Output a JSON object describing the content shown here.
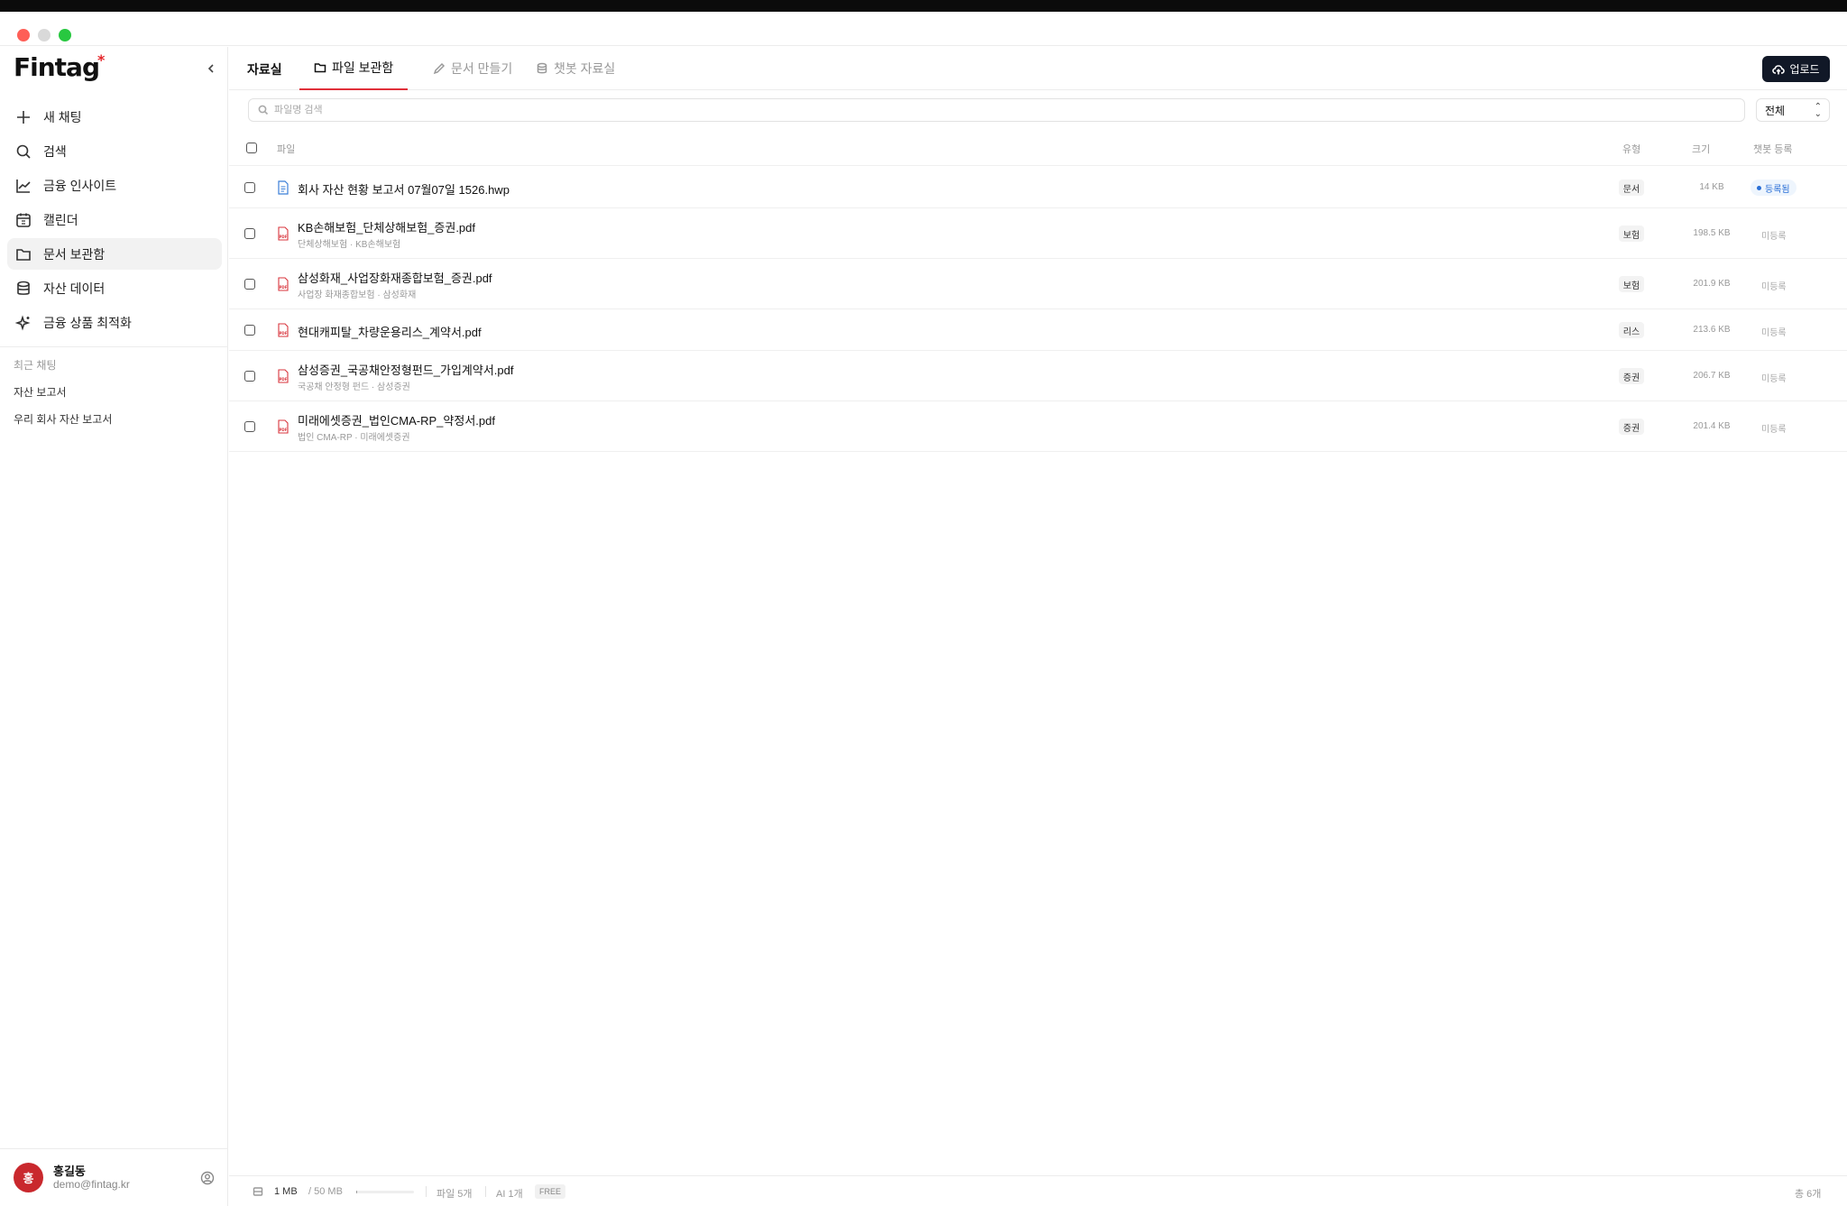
{
  "app": {
    "logo_text": "Fintag",
    "logo_mark": "*"
  },
  "sidebar": {
    "items": [
      {
        "label": "새 채팅",
        "icon": "plus-icon",
        "active": false
      },
      {
        "label": "검색",
        "icon": "search-icon",
        "active": false
      },
      {
        "label": "금융 인사이트",
        "icon": "chart-line-icon",
        "active": false
      },
      {
        "label": "캘린더",
        "icon": "calendar-icon",
        "active": false
      },
      {
        "label": "문서 보관함",
        "icon": "folder-icon",
        "active": true
      },
      {
        "label": "자산 데이터",
        "icon": "database-icon",
        "active": false
      },
      {
        "label": "금융 상품 최적화",
        "icon": "sparkle-icon",
        "active": false
      }
    ],
    "recent_title": "최근 채팅",
    "recent": [
      "자산 보고서",
      "우리 회사 자산 보고서"
    ],
    "user": {
      "avatar_text": "홍",
      "name": "홍길동",
      "email": "demo@fintag.kr"
    }
  },
  "tabs": {
    "root": "자료실",
    "items": [
      {
        "label": "파일 보관함",
        "icon": "folder-icon",
        "active": true
      },
      {
        "label": "문서 만들기",
        "icon": "pencil-icon",
        "active": false
      },
      {
        "label": "챗봇 자료실",
        "icon": "database-icon",
        "active": false
      }
    ],
    "upload_label": "업로드"
  },
  "search": {
    "placeholder": "파일명 검색",
    "value": ""
  },
  "filter": {
    "selected": "전체"
  },
  "table": {
    "headers": {
      "file": "파일",
      "type": "유형",
      "size": "크기",
      "bot": "챗봇 등록"
    },
    "rows": [
      {
        "name": "회사 자산 현황 보고서 07월07일 1526.hwp",
        "sub": "",
        "kind": "doc",
        "type": "문서",
        "size": "14 KB",
        "registered": true,
        "status": "등록됨"
      },
      {
        "name": "KB손해보험_단체상해보험_증권.pdf",
        "sub": "단체상해보험 · KB손해보험",
        "kind": "pdf",
        "type": "보험",
        "size": "198.5 KB",
        "registered": false,
        "status": "미등록"
      },
      {
        "name": "삼성화재_사업장화재종합보험_증권.pdf",
        "sub": "사업장 화재종합보험 · 삼성화재",
        "kind": "pdf",
        "type": "보험",
        "size": "201.9 KB",
        "registered": false,
        "status": "미등록"
      },
      {
        "name": "현대캐피탈_차량운용리스_계약서.pdf",
        "sub": "",
        "kind": "pdf",
        "type": "리스",
        "size": "213.6 KB",
        "registered": false,
        "status": "미등록"
      },
      {
        "name": "삼성증권_국공채안정형펀드_가입계약서.pdf",
        "sub": "국공채 안정형 펀드 · 삼성증권",
        "kind": "pdf",
        "type": "증권",
        "size": "206.7 KB",
        "registered": false,
        "status": "미등록"
      },
      {
        "name": "미래에셋증권_법인CMA-RP_약정서.pdf",
        "sub": "법인 CMA-RP · 미래에셋증권",
        "kind": "pdf",
        "type": "증권",
        "size": "201.4 KB",
        "registered": false,
        "status": "미등록"
      }
    ]
  },
  "footer": {
    "used": "1 MB",
    "total": "/ 50 MB",
    "usage_fraction": 0.02,
    "files": "파일 5개",
    "ai": "AI 1개",
    "plan": "FREE",
    "count": "총 6개"
  },
  "colors": {
    "accent": "#e0303a",
    "brand_dark": "#111827",
    "registered_blue": "#2a6fd6",
    "pdf_red": "#d9363e",
    "avatar_red": "#c9282d"
  }
}
